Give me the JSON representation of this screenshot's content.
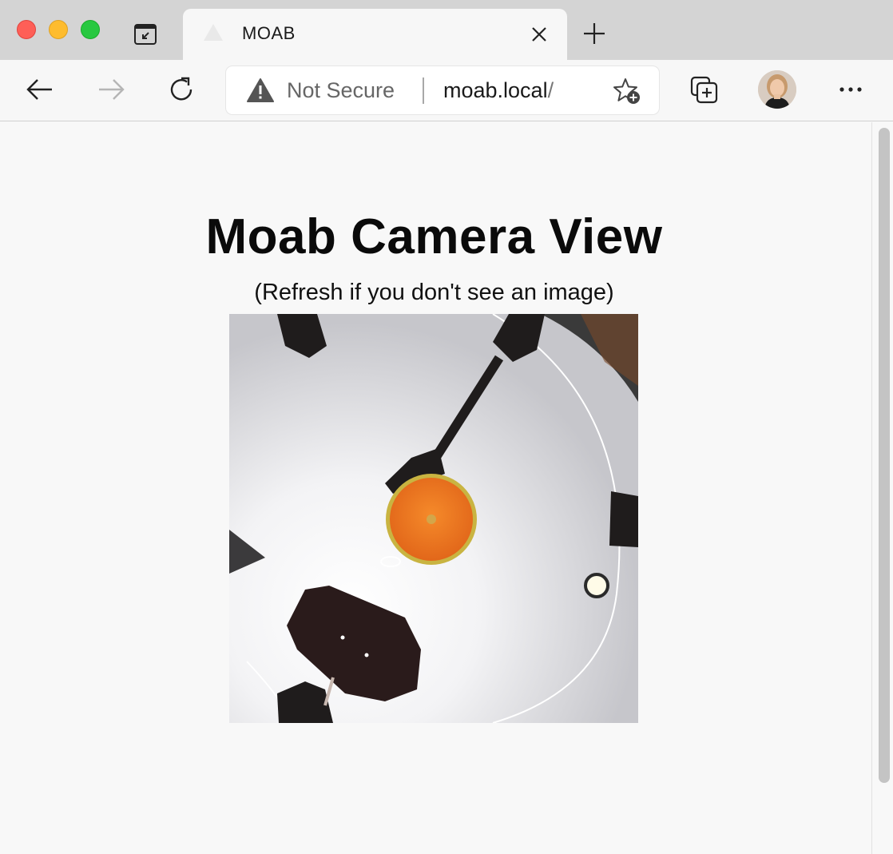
{
  "browser": {
    "tab": {
      "title": "MOAB"
    },
    "address_bar": {
      "security_label": "Not Secure",
      "host": "moab.local",
      "path": "/"
    },
    "icons": {
      "back": "back-arrow-icon",
      "forward": "forward-arrow-icon",
      "reload": "reload-icon",
      "tab_actions": "tab-actions-icon",
      "close_tab": "close-icon",
      "new_tab": "plus-icon",
      "warning": "warning-icon",
      "add_favorite": "star-plus-icon",
      "collections": "collections-icon",
      "more": "more-icon"
    }
  },
  "page": {
    "title": "Moab Camera View",
    "subtitle": "(Refresh if you don't see an image)"
  },
  "colors": {
    "ball": "#f07820",
    "ball_ring": "#c9b441",
    "traffic_red": "#fe5f57",
    "traffic_yellow": "#febc2e",
    "traffic_green": "#28c840"
  }
}
